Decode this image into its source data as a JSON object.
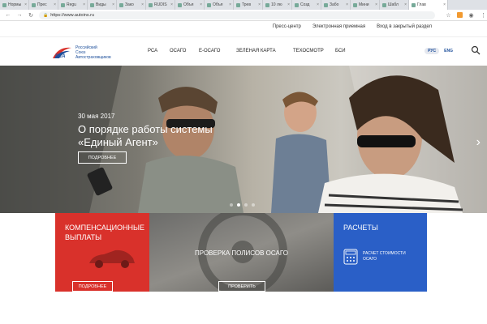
{
  "browser": {
    "tabs": [
      {
        "label": "Нормы"
      },
      {
        "label": "Прес"
      },
      {
        "label": "Regu"
      },
      {
        "label": "Виды"
      },
      {
        "label": "Зако"
      },
      {
        "label": "RUDIS"
      },
      {
        "label": "Объя"
      },
      {
        "label": "Объя"
      },
      {
        "label": "Трев"
      },
      {
        "label": "10 лю"
      },
      {
        "label": "Созд"
      },
      {
        "label": "Забо"
      },
      {
        "label": "Мини"
      },
      {
        "label": "Шабл"
      },
      {
        "label": "Глав",
        "active": true
      }
    ],
    "url": "https://www.autoins.ru"
  },
  "utility_nav": {
    "items": [
      "Пресс-центр",
      "Электронная приемная",
      "Вход в закрытый раздел"
    ]
  },
  "logo": {
    "mark": "РСА",
    "lines": [
      "Российский",
      "Союз",
      "Автостраховщиков"
    ]
  },
  "main_nav": {
    "items": [
      "РСА",
      "ОСАГО",
      "Е-ОСАГО",
      "ЗЕЛЕНАЯ КАРТА",
      "ТЕХОСМОТР",
      "БСИ"
    ]
  },
  "language": {
    "active": "РУС",
    "other": "ENG"
  },
  "hero": {
    "date": "30 мая 2017",
    "title_line1": "О порядке работы системы",
    "title_line2": "«Единый Агент»",
    "button": "ПОДРОБНЕЕ",
    "slide_count": 4,
    "current_slide": 2
  },
  "tiles": {
    "compensation": {
      "title_line1": "КОМПЕНСАЦИОННЫЕ",
      "title_line2": "ВЫПЛАТЫ",
      "button": "ПОДРОБНЕЕ",
      "color": "#d9312b"
    },
    "check": {
      "title": "ПРОВЕРКА ПОЛИСОВ ОСАГО",
      "button": "ПРОВЕРИТЬ"
    },
    "calc": {
      "title": "РАСЧЕТЫ",
      "link_line1": "РАСЧЕТ СТОИМОСТИ",
      "link_line2": "ОСАГО",
      "color": "#2a5fc7"
    }
  }
}
